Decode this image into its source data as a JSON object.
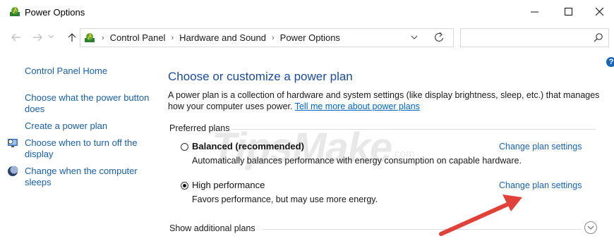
{
  "window": {
    "title": "Power Options"
  },
  "address": {
    "crumbs": [
      "Control Panel",
      "Hardware and Sound",
      "Power Options"
    ],
    "search_placeholder": ""
  },
  "sidebar": {
    "home": "Control Panel Home",
    "items": [
      {
        "label": "Choose what the power button does"
      },
      {
        "label": "Create a power plan"
      },
      {
        "label": "Choose when to turn off the display",
        "icon": "monitor-clock-icon"
      },
      {
        "label": "Change when the computer sleeps",
        "icon": "moon-icon"
      }
    ]
  },
  "main": {
    "heading": "Choose or customize a power plan",
    "description": "A power plan is a collection of hardware and system settings (like display brightness, sleep, etc.) that manages how your computer uses power.",
    "learn_more": "Tell me more about power plans",
    "preferred_label": "Preferred plans",
    "plans": [
      {
        "name": "Balanced (recommended)",
        "desc": "Automatically balances performance with energy consumption on capable hardware.",
        "selected": false,
        "change": "Change plan settings"
      },
      {
        "name": "High performance",
        "desc": "Favors performance, but may use more energy.",
        "selected": true,
        "change": "Change plan settings"
      }
    ],
    "show_more": "Show additional plans"
  },
  "watermark": {
    "brand": "TipsMake",
    "suffix": ".com"
  },
  "colors": {
    "link": "#1a64b5",
    "heading": "#1a4b9c",
    "arrow": "#e0423a"
  }
}
